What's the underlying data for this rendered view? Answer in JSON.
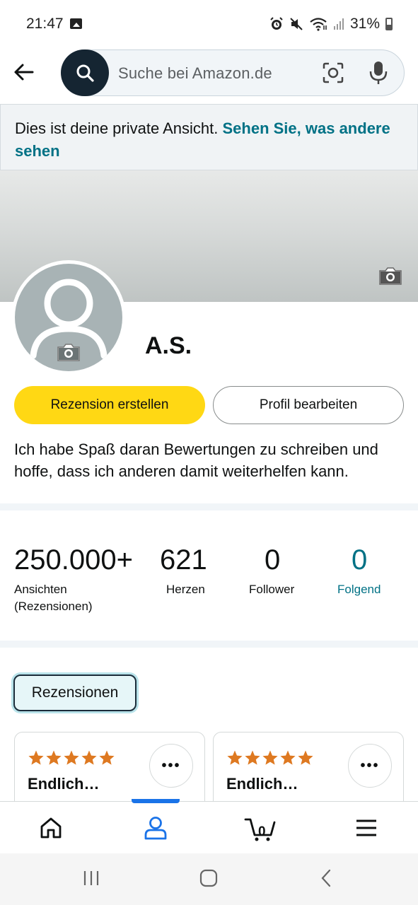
{
  "status_bar": {
    "time": "21:47",
    "battery": "31%",
    "icons": [
      "image-icon",
      "alarm-icon",
      "mute-icon",
      "wifi-icon",
      "signal-icon",
      "battery-icon"
    ]
  },
  "search": {
    "placeholder": "Suche bei Amazon.de"
  },
  "banner": {
    "text": "Dies ist deine private Ansicht.",
    "link": "Sehen Sie, was andere sehen"
  },
  "profile": {
    "name": "A.S.",
    "bio": "Ich habe Spaß daran Bewertungen zu schreiben und hoffe, dass ich anderen damit weiterhelfen kann."
  },
  "actions": {
    "create_review": "Rezension erstellen",
    "edit_profile": "Profil bearbeiten"
  },
  "stats": [
    {
      "value": "250.000+",
      "label": "Ansichten (Rezensionen)"
    },
    {
      "value": "621",
      "label": "Herzen"
    },
    {
      "value": "0",
      "label": "Follower"
    },
    {
      "value": "0",
      "label": "Folgend"
    }
  ],
  "tabs": {
    "reviews": "Rezensionen"
  },
  "cards": [
    {
      "rating": 5,
      "title": "Endlich…",
      "more": "•••"
    },
    {
      "rating": 5,
      "title": "Endlich…",
      "more": "•••"
    }
  ],
  "bottom_nav": {
    "cart_count": "0",
    "items": [
      "home-icon",
      "profile-icon",
      "cart-icon",
      "menu-icon"
    ]
  },
  "colors": {
    "accent_yellow": "#ffd814",
    "link_teal": "#007185",
    "dark_navy": "#152532",
    "star_orange": "#de7921",
    "active_blue": "#1a73e8"
  }
}
